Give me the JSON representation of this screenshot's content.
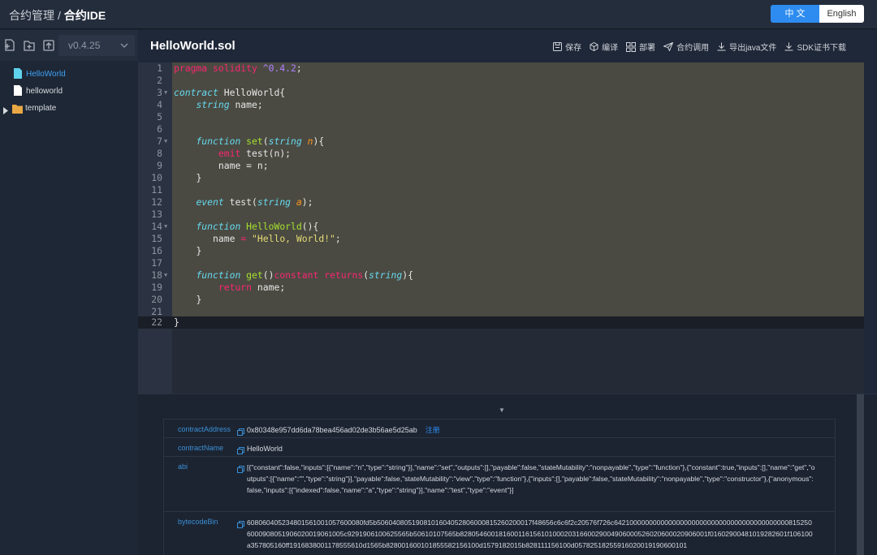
{
  "header": {
    "breadcrumb_root": "合约管理",
    "breadcrumb_sep": "/",
    "breadcrumb_current": "合约IDE",
    "lang_zh": "中 文",
    "lang_en": "English"
  },
  "sidebar": {
    "version": "v0.4.25",
    "tools": [
      "new-file-icon",
      "new-folder-icon",
      "upload-icon"
    ],
    "tree": [
      {
        "label": "HelloWorld",
        "icon": "file-icon",
        "active": true
      },
      {
        "label": "helloworld",
        "icon": "file-icon",
        "active": false
      },
      {
        "label": "template",
        "icon": "folder-icon",
        "active": false
      }
    ]
  },
  "editor": {
    "filename": "HelloWorld.sol",
    "actions": [
      "保存",
      "编译",
      "部署",
      "合约调用",
      "导出java文件",
      "SDK证书下载"
    ],
    "line_numbers": [
      "1",
      "2",
      "3",
      "4",
      "5",
      "6",
      "7",
      "8",
      "9",
      "10",
      "11",
      "12",
      "13",
      "14",
      "15",
      "16",
      "17",
      "18",
      "19",
      "20",
      "21",
      "22"
    ],
    "code": {
      "l1_kw": "pragma solidity",
      "l1_ver": "^0.4.2",
      "l3_kw": "contract",
      "l3_name": " HelloWorld{",
      "l4_type": "string",
      "l4_rest": " name;",
      "l7_kw": "function",
      "l7_fn": "set",
      "l7_type": "string",
      "l7_param": "n",
      "l8_kw": "emit",
      "l8_rest": " test(n);",
      "l9": "name = n;",
      "l10": "}",
      "l12_kw": "event",
      "l12_mid": " test(",
      "l12_type": "string",
      "l12_param": "a",
      "l12_end": ");",
      "l14_kw": "function",
      "l14_fn": "HelloWorld",
      "l14_end": "(){",
      "l15_a": "name",
      "l15_str": "\"Hello, World!\"",
      "l16": "}",
      "l18_kw": "function",
      "l18_fn": "get",
      "l18_const": "constant",
      "l18_ret": "returns",
      "l18_type": "string",
      "l19_kw": "return",
      "l19_rest": " name;",
      "l20": "}",
      "l22": "}"
    }
  },
  "info": {
    "address_key": "contractAddress",
    "address_val": "0x80348e957dd6da78bea456ad02de3b56ae5d25ab",
    "register": "注册",
    "name_key": "contractName",
    "name_val": "HelloWorld",
    "abi_key": "abi",
    "abi_val": "[{\"constant\":false,\"inputs\":[{\"name\":\"n\",\"type\":\"string\"}],\"name\":\"set\",\"outputs\":[],\"payable\":false,\"stateMutability\":\"nonpayable\",\"type\":\"function\"},{\"constant\":true,\"inputs\":[],\"name\":\"get\",\"outputs\":[{\"name\":\"\",\"type\":\"string\"}],\"payable\":false,\"stateMutability\":\"view\",\"type\":\"function\"},{\"inputs\":[],\"payable\":false,\"stateMutability\":\"nonpayable\",\"type\":\"constructor\"},{\"anonymous\":false,\"inputs\":[{\"indexed\":false,\"name\":\"a\",\"type\":\"string\"}],\"name\":\"test\",\"type\":\"event\"}]",
    "bin_key": "bytecodeBin",
    "bin_val": "608060405234801561001057600080fd5b5060408051908101604052806000815260200017f48656c6c6f2c20576f726c6421000000000000000000000000000000000000000008152506000908051906020019061005c9291906100625565b50610107565b8280546001816001161561010002031660029004906000526020600020906001f01602900481019282601f106100a357805160ff1916838001178555610d1565b828001600101855582156100d1579182015b828111156100d05782518255916020019190600101"
  }
}
